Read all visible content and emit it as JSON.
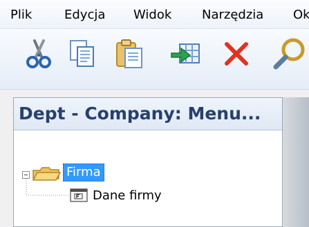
{
  "menu": {
    "items": [
      "Plik",
      "Edycja",
      "Widok",
      "Narzędzia",
      "Ok"
    ]
  },
  "toolbar": {
    "icons": [
      "scissors-icon",
      "copy-icon",
      "paste-icon",
      "export-icon",
      "delete-icon",
      "search-icon"
    ]
  },
  "panel": {
    "title": "Dept - Company: Menu..."
  },
  "tree": {
    "root_label": "Firma",
    "child_label": "Dane firmy"
  },
  "colors": {
    "selection": "#3399ff",
    "title": "#27406d",
    "delete": "#e03322",
    "folder": "#f0c35b"
  }
}
